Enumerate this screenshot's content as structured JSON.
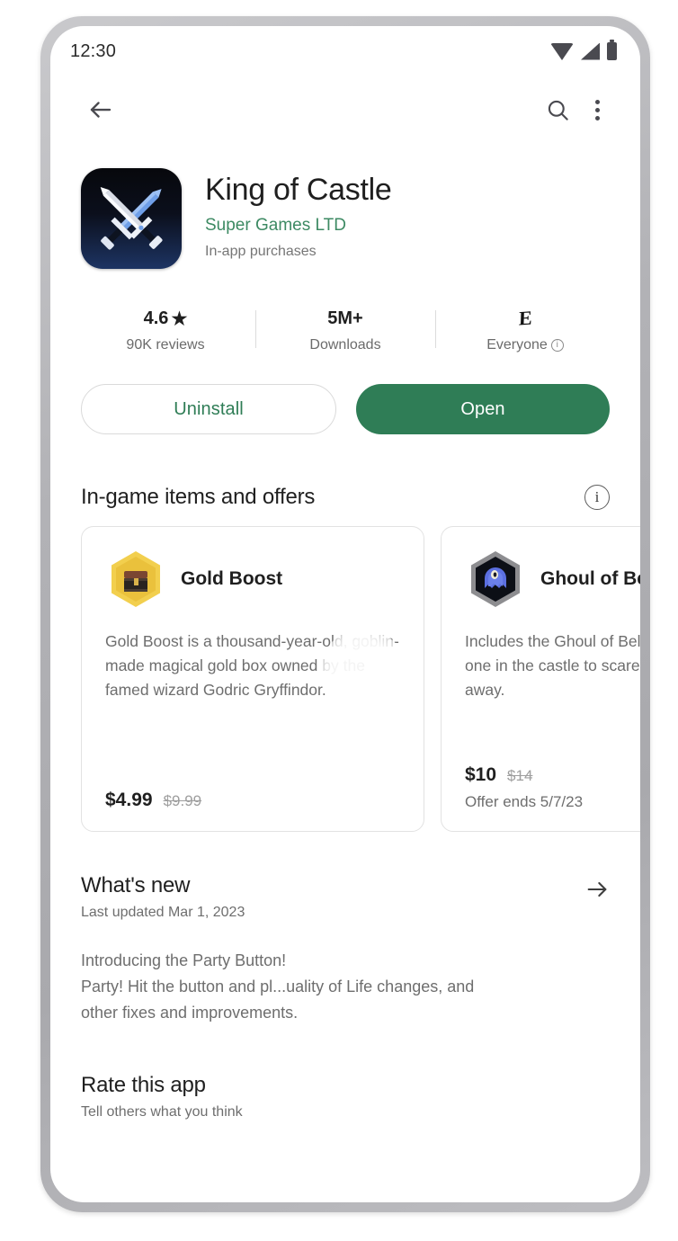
{
  "status_bar": {
    "time": "12:30",
    "icons": [
      "wifi-icon",
      "cellular-signal-icon",
      "battery-icon"
    ]
  },
  "app_bar": {
    "back_icon": "back-arrow-icon",
    "search_icon": "search-icon",
    "overflow_icon": "more-vertical-icon"
  },
  "app": {
    "title": "King of Castle",
    "developer": "Super Games LTD",
    "iap_note": "In-app purchases",
    "icon_name": "crossed-swords-app-icon"
  },
  "stats": [
    {
      "value": "4.6",
      "star": "★",
      "label": "90K reviews",
      "type": "rating"
    },
    {
      "value": "5M+",
      "label": "Downloads",
      "type": "downloads"
    },
    {
      "value": "E",
      "label": "Everyone",
      "info": "ⓘ",
      "type": "content-rating"
    }
  ],
  "actions": {
    "uninstall_label": "Uninstall",
    "open_label": "Open"
  },
  "in_game": {
    "section_title": "In-game items and offers",
    "info_glyph": "i",
    "cards": [
      {
        "name": "Gold Boost",
        "icon_name": "gold-chest-hex-icon",
        "description": "Gold Boost is a thousand-year-old, goblin-made magical gold box owned by the famed wizard Godric Gryffindor.",
        "price": "$4.99",
        "old_price": "$9.99",
        "offer_ends": ""
      },
      {
        "name": "Ghoul of Belgrade",
        "icon_name": "blue-ghoul-hex-icon",
        "description": "Includes the Ghoul of Belgrade, the best one in the castle to scare the enemies away.",
        "price": "$10",
        "old_price": "$14",
        "offer_ends": "Offer ends 5/7/23"
      }
    ]
  },
  "whats_new": {
    "title": "What's new",
    "subtitle": "Last updated Mar 1, 2023",
    "arrow_icon": "arrow-right-icon",
    "changelog_line1": "Introducing the Party Button!",
    "changelog_line2": "Party! Hit the button and pl...uality of Life changes, and",
    "changelog_line3": "other fixes and improvements."
  },
  "rate_app": {
    "title": "Rate this app",
    "subtitle": "Tell others what you think"
  },
  "colors": {
    "brand_green": "#2f7d56",
    "developer_green": "#3d8a63",
    "text_primary": "#1f1f1f",
    "text_secondary": "#6e6e6e",
    "card_border": "#e2e2e2",
    "bezel": "#b2b2b6"
  }
}
